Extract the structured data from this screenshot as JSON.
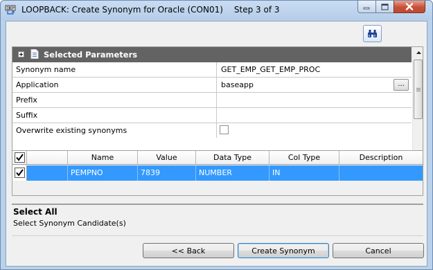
{
  "window": {
    "title": "LOOPBACK: Create Synonym for Oracle (CON01)",
    "step": "Step 3 of 3"
  },
  "toolbar": {
    "find_icon": "binoculars-icon"
  },
  "properties": {
    "header": "Selected Parameters",
    "rows": [
      {
        "name": "Synonym name",
        "value": "GET_EMP_GET_EMP_PROC"
      },
      {
        "name": "Application",
        "value": "baseapp",
        "button_label": "..."
      },
      {
        "name": "Prefix",
        "value": ""
      },
      {
        "name": "Suffix",
        "value": ""
      },
      {
        "name": "Overwrite existing synonyms",
        "checked": false
      }
    ]
  },
  "columns_grid": {
    "header_checked": true,
    "headers": {
      "name": "Name",
      "value": "Value",
      "data_type": "Data Type",
      "col_type": "Col Type",
      "description": "Description"
    },
    "rows": [
      {
        "checked": true,
        "selected": true,
        "name": "PEMPNO",
        "value": "7839",
        "data_type": "NUMBER",
        "col_type": "IN",
        "description": ""
      }
    ]
  },
  "description_pane": {
    "title": "Select All",
    "text": "Select Synonym Candidate(s)"
  },
  "buttons": {
    "back": "<< Back",
    "create": "Create Synonym",
    "cancel": "Cancel"
  },
  "colors": {
    "selection": "#3399ff",
    "header_bar": "#636363",
    "title_bar": "#b9d1ea",
    "close_button": "#c75039"
  }
}
